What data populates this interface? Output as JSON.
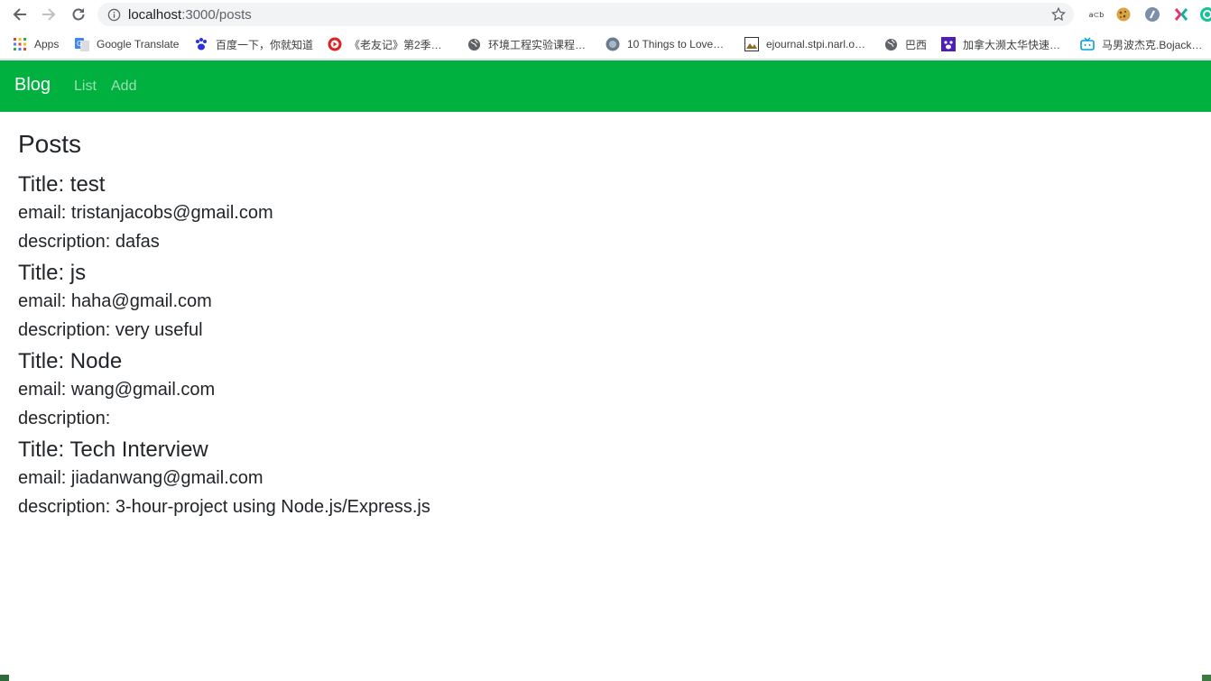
{
  "browser": {
    "url_host": "localhost",
    "url_path": ":3000/posts",
    "icons": {
      "back": "arrow-left-icon",
      "forward": "arrow-right-icon",
      "reload": "reload-icon",
      "info": "info-icon",
      "bookmark": "star-icon"
    },
    "extensions": [
      {
        "name": "ext-1",
        "label": "a⊂b"
      },
      {
        "name": "cookie-icon"
      },
      {
        "name": "ext-3"
      },
      {
        "name": "ext-4"
      },
      {
        "name": "grammarly-icon"
      }
    ]
  },
  "bookmarks": [
    {
      "label": "Apps",
      "icon": "apps-grid-icon"
    },
    {
      "label": "Google Translate",
      "icon": "google-translate-icon"
    },
    {
      "label": "百度一下，你就知道",
      "icon": "baidu-paw-icon"
    },
    {
      "label": "《老友记》第2季…",
      "icon": "video-play-icon"
    },
    {
      "label": "环境工程实验课程…",
      "icon": "globe-icon"
    },
    {
      "label": "10 Things to Love…",
      "icon": "site-icon"
    },
    {
      "label": "ejournal.stpi.narl.o…",
      "icon": "journal-icon"
    },
    {
      "label": "巴西",
      "icon": "globe-icon"
    },
    {
      "label": "加拿大濒太华快速…",
      "icon": "paw-icon"
    },
    {
      "label": "马男波杰克.Bojack…",
      "icon": "tv-icon"
    }
  ],
  "navbar": {
    "brand": "Blog",
    "links": [
      "List",
      "Add"
    ],
    "color": "#00b140"
  },
  "page": {
    "heading": "Posts",
    "posts": [
      {
        "title": "Title: test",
        "email": "email: tristanjacobs@gmail.com",
        "description": "description: dafas"
      },
      {
        "title": "Title: js",
        "email": "email: haha@gmail.com",
        "description": "description: very useful"
      },
      {
        "title": "Title: Node",
        "email": "email: wang@gmail.com",
        "description": "description:"
      },
      {
        "title": "Title: Tech Interview",
        "email": "email: jiadanwang@gmail.com",
        "description": "description: 3-hour-project using Node.js/Express.js"
      }
    ]
  }
}
